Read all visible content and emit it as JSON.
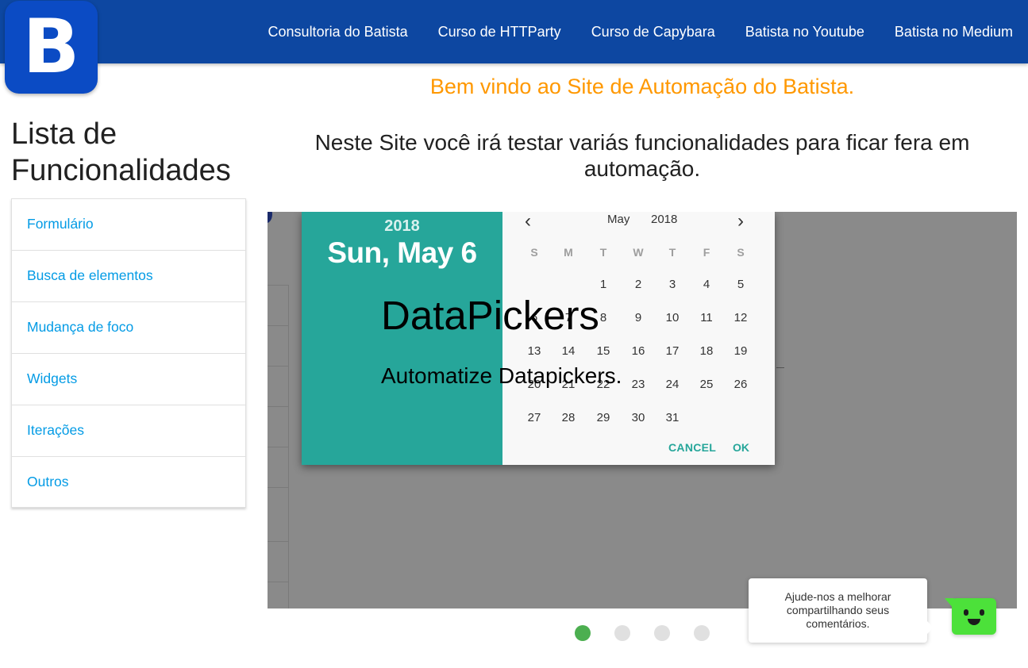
{
  "logo": {
    "letter": "B"
  },
  "nav": {
    "links": [
      "Consultoria do Batista",
      "Curso de HTTParty",
      "Curso de Capybara",
      "Batista no Youtube",
      "Batista no Medium"
    ]
  },
  "main": {
    "welcome": "Bem vindo ao Site de Automação do Batista.",
    "subtitle": "Neste Site você irá testar variás funcionalidades para ficar fera em automação."
  },
  "sidebar": {
    "title": "Lista de Funcionalidades",
    "items": [
      "Formulário",
      "Busca de elementos",
      "Mudança de foco",
      "Widgets",
      "Iterações",
      "Outros"
    ]
  },
  "carousel": {
    "slide_title": "DataPickers",
    "slide_subtitle": "Automatize Datapickers.",
    "indicator_count": 4,
    "active_index": 0,
    "datepicker": {
      "header_year": "2018",
      "header_date": "Sun, May 6",
      "month": "May",
      "year": "2018",
      "weekdays": [
        "S",
        "M",
        "T",
        "W",
        "T",
        "F",
        "S"
      ],
      "first_weekday_index": 2,
      "days_in_month": 31,
      "cancel_label": "CANCEL",
      "ok_label": "OK",
      "prev_icon": "chevron-left-icon",
      "next_icon": "chevron-right-icon"
    }
  },
  "feedback": {
    "lines": [
      "Ajude-nos a melhorar",
      "compartilhando seus",
      "comentários."
    ]
  },
  "colors": {
    "navbar": "#0d47a1",
    "welcome": "#ff9800",
    "link": "#039be5",
    "datepicker_accent": "#26a69a",
    "indicator_active": "#4caf50",
    "bot": "#4ce13a"
  }
}
